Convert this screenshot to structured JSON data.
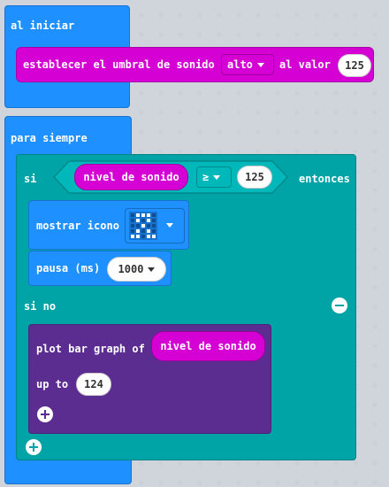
{
  "on_start": {
    "label": "al iniciar",
    "set_threshold_label": "establecer el umbral de sonido",
    "threshold_option": "alto",
    "value_label": "al valor",
    "value": "125"
  },
  "forever": {
    "label": "para siempre",
    "if_label": "si",
    "condition_reporter": "nivel de sonido",
    "operator": "≥",
    "compare_value": "125",
    "then_label": "entonces",
    "show_icon_label": "mostrar icono",
    "pause_label": "pausa (ms)",
    "pause_value": "1000",
    "else_label": "si no",
    "plot_label": "plot bar graph of",
    "plot_reporter": "nivel de sonido",
    "up_to_label": "up to",
    "up_to_value": "124"
  },
  "colors": {
    "event": "#1e90ff",
    "music": "#d400d4",
    "logic": "#00a4a6",
    "extension": "#5c2d91",
    "canvas": "#edeff1"
  },
  "icons": [
    "dropdown-caret-icon",
    "led-icon-preview",
    "remove-else-icon",
    "add-else-if-icon",
    "add-argument-icon"
  ]
}
